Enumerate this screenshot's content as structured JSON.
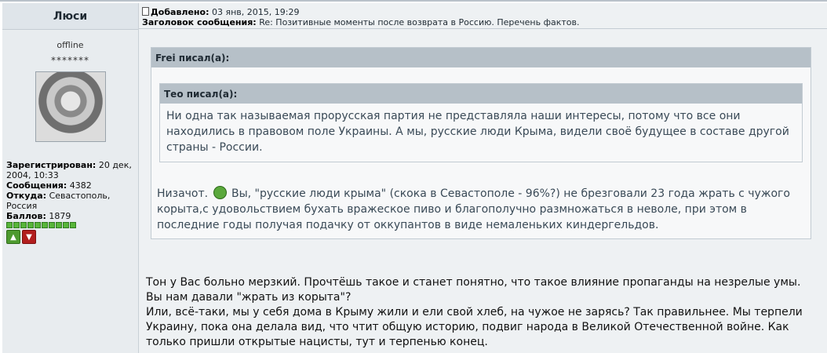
{
  "profile": {
    "username": "Люси",
    "status": "offline",
    "rank_stars": "*******",
    "registered_label": "Зарегистрирован:",
    "registered_value": "20 дек, 2004, 10:33",
    "messages_label": "Сообщения:",
    "messages_value": "4382",
    "from_label": "Откуда:",
    "from_value": "Севастополь, Россия",
    "points_label": "Баллов:",
    "points_value": "1879",
    "reputation_blocks": 10
  },
  "post": {
    "added_label": "Добавлено:",
    "added_value": "03 янв, 2015, 19:29",
    "subject_label": "Заголовок сообщения:",
    "subject_value": "Re: Позитивные моменты после возврата в Россию. Перечень фактов."
  },
  "quote_outer": {
    "header": "Frei писал(а):",
    "text_before_smiley": "Низачот.",
    "text_after_smiley": "Вы, \"русские люди крыма\" (скока в Севастополе - 96%?) не брезговали 23 года жрать с чужого корыта,с удовольствием бухать вражеское пиво и благополучно размножаться в неволе, при этом в последние годы получая подачку от оккупантов в виде немаленьких киндергельдов."
  },
  "quote_inner": {
    "header": "Тео писал(а):",
    "text": "Ни одна так называемая прорусская партия не представляла наши интересы, потому что все они находились в правовом поле Украины. А мы, русские люди Крыма, видели своё будущее в составе другой страны - России."
  },
  "message": {
    "line1": "Тон у Вас больно мерзкий. Прочтёшь такое и станет понятно, что такое влияние пропаганды на незрелые умы.",
    "line2": "Вы нам давали \"жрать из корыта\"?",
    "line3": "Или, всё-таки, мы у себя дома в Крыму жили и ели свой хлеб, на чужое не зарясь? Так правильнее. Мы терпели Украину, пока она делала вид, что чтит общую историю, подвиг народа в Великой Отечественной войне. Как только пришли открытые нацисты, тут и терпенью конец."
  },
  "icons": {
    "thumb_up": "thumbs-up-icon",
    "thumb_down": "thumbs-down-icon",
    "smiley": "smiley-icon",
    "post": "post-icon"
  },
  "colors": {
    "quote_header": "#b6c0c8",
    "reputation": "#58b53a",
    "vote_up": "#4e9a2f",
    "vote_down": "#b21e1e"
  }
}
